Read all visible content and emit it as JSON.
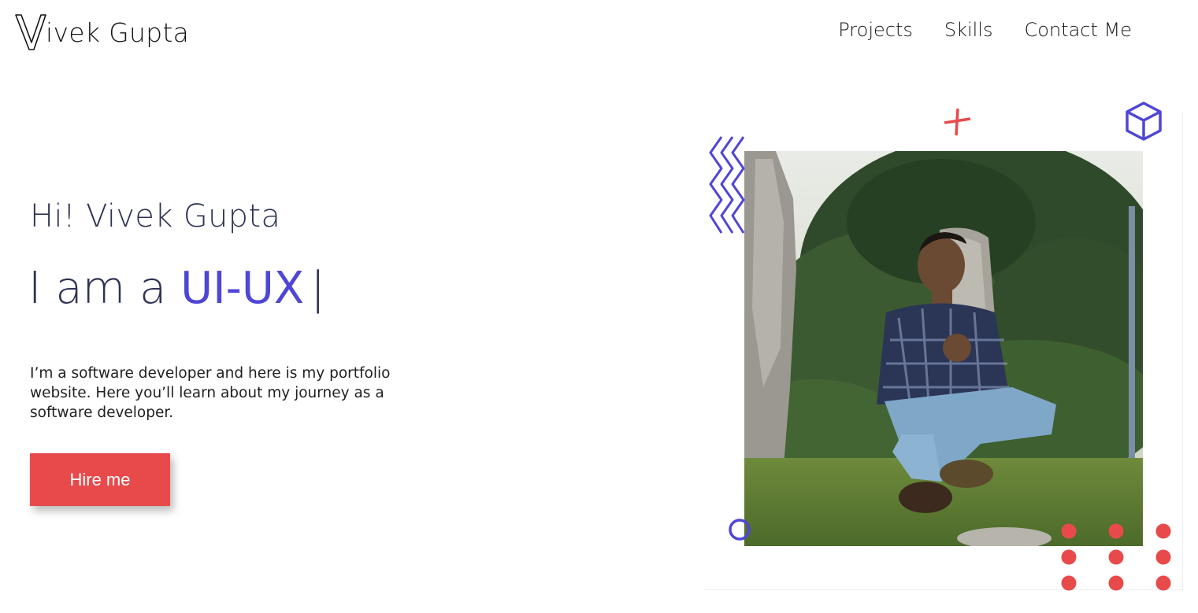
{
  "header": {
    "logo_icon": "v-letter-logo",
    "logo_text": "ivek Gupta",
    "nav": [
      {
        "label": "Projects"
      },
      {
        "label": "Skills"
      },
      {
        "label": "Contact Me"
      }
    ]
  },
  "hero": {
    "greeting": "Hi! Vivek Gupta",
    "role_prefix": "I am a ",
    "role_word": "UI-UX",
    "caret": "|",
    "intro": "I’m a software developer and here is my portfolio website. Here you’ll learn about my journey as a software developer.",
    "cta_label": "Hire me"
  },
  "colors": {
    "accent_purple": "#4f46d6",
    "accent_red": "#e84a4b",
    "heading_navy": "#2e3356"
  },
  "decorations": [
    "zigzag-icon",
    "plus-icon",
    "cube-icon",
    "circle-icon",
    "dot-grid-icon"
  ]
}
